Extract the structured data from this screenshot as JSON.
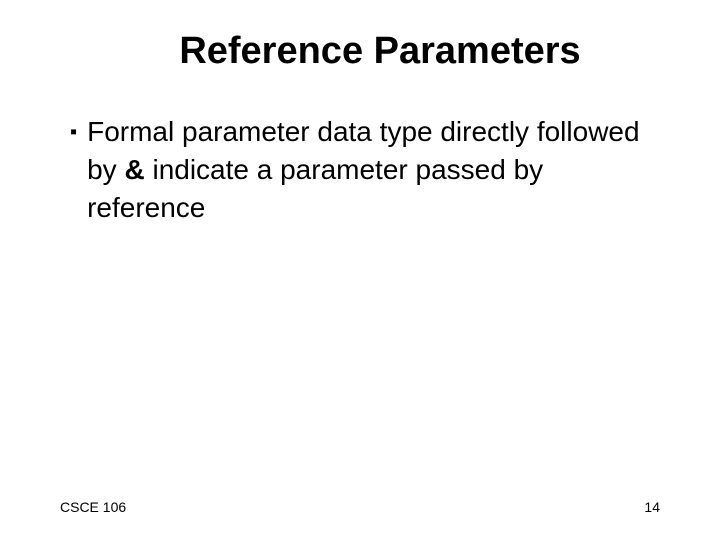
{
  "title": "Reference Parameters",
  "bullets": [
    {
      "prefix": "Formal parameter data type directly followed by ",
      "bold": "&",
      "suffix": " indicate a parameter passed by reference"
    }
  ],
  "footer": {
    "left": "CSCE 106",
    "right": "14"
  }
}
